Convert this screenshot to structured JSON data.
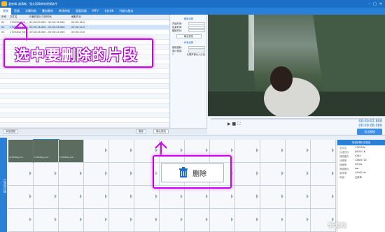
{
  "window": {
    "app_name": "爱剪辑",
    "subtitle": "超清晰、强大而简单的视频软件"
  },
  "menu": [
    "视频",
    "音频",
    "字幕特效",
    "叠加素材",
    "转场特效",
    "画面风格",
    "MTV",
    "卡拉OK",
    "升级与服务"
  ],
  "clip_table": {
    "columns": [
      "序号",
      "文件名",
      "在最终影片中的时间",
      "截取时长"
    ],
    "rows": [
      {
        "no": "01",
        "name": "17053Ga_hd_...",
        "time": "00:00:00.000 - 00:00:16.000",
        "dur": "00:00:16.0"
      },
      {
        "no": "02",
        "name": "17053Ga_hd_...",
        "time": "00:00:16.000 - 00:00:28.000",
        "dur": "00:00:12.0"
      },
      {
        "no": "03",
        "name": "17053Ga_hd_...",
        "time": "00:00:28.000 - 00:00:41.000",
        "dur": "00:00:13.0"
      }
    ]
  },
  "props": {
    "header": "截取设置",
    "fields": [
      "开始时间:",
      "结束时间:",
      "截取时长:"
    ],
    "apply_button": "确定修改",
    "audio_header": "声音设置",
    "audio_fields": [
      "使用音轨:",
      "原片音量:"
    ],
    "checkbox_label": "头尾声音淡入淡出"
  },
  "bottom_bar": {
    "add_button": "添加视频",
    "delete_button": "删除",
    "confirm_button": "确认修改"
  },
  "player": {
    "time_current": "00:00:02.800",
    "time_total": "00:00:08.080",
    "export_button": "导出视频"
  },
  "timeline": {
    "side_label": "已添加片段",
    "clips": [
      "17053Ga_hd...",
      "17053Ga_hd...",
      "17053Ga_hd..."
    ]
  },
  "info_panel": {
    "header": "所选剪辑片的信息",
    "items": [
      {
        "k": "文件名:",
        "v": "17053Ga"
      },
      {
        "k": "片段时长:",
        "v": "00:00:16"
      },
      {
        "k": "视频格式:",
        "v": "h264"
      },
      {
        "k": "分辨率:",
        "v": "1280x720"
      },
      {
        "k": "帧速率:",
        "v": "25 fps"
      },
      {
        "k": "音频格式:",
        "v": "aac"
      },
      {
        "k": "采样率:",
        "v": "44100 Hz"
      },
      {
        "k": "声道:",
        "v": "立体声"
      }
    ]
  },
  "annotation_top": "选中要删除的片段",
  "annotation_bottom": "删除",
  "watermark": "手游网",
  "colors": {
    "accent": "#2a7fd6",
    "highlight": "#cc00ee"
  }
}
